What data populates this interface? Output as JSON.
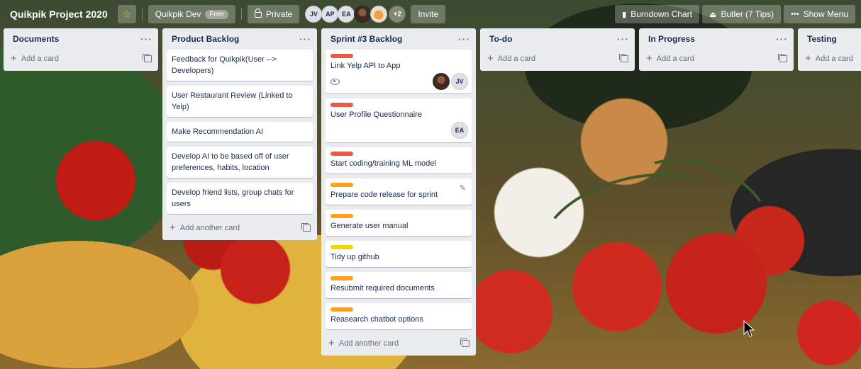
{
  "header": {
    "board_title": "Quikpik Project 2020",
    "team_name": "Quikpik Dev",
    "team_badge": "Free",
    "visibility": "Private",
    "members": [
      "JV",
      "AP",
      "EA"
    ],
    "more_members": "+2",
    "invite": "Invite",
    "burndown": "Burndown Chart",
    "butler": "Butler (7 Tips)",
    "show_menu": "Show Menu"
  },
  "colors": {
    "label_red": "#eb5a46",
    "label_orange": "#ff9f1a",
    "label_yellow": "#f2d600",
    "list_bg": "#ebecf0"
  },
  "lists": [
    {
      "title": "Documents",
      "add_label": "Add a card",
      "cards": []
    },
    {
      "title": "Product Backlog",
      "add_label": "Add another card",
      "cards": [
        {
          "title": "Feedback for Quikpik(User --> Developers)"
        },
        {
          "title": "User Restaurant Review (Linked to Yelp)"
        },
        {
          "title": "Make Recommendation AI"
        },
        {
          "title": "Develop AI to be based off of user preferences, habits, location"
        },
        {
          "title": "Develop friend lists, group chats for users"
        }
      ]
    },
    {
      "title": "Sprint #3 Backlog",
      "add_label": "Add another card",
      "cards": [
        {
          "title": "Link Yelp API to App",
          "label": "red",
          "members": [
            "photo",
            "JV"
          ]
        },
        {
          "title": "User Profile Questionnaire",
          "label": "red",
          "members": [
            "EA"
          ]
        },
        {
          "title": "Start coding/training ML model",
          "label": "red"
        },
        {
          "title": "Prepare code release for sprint",
          "label": "orange"
        },
        {
          "title": "Generate user manual",
          "label": "orange"
        },
        {
          "title": "Tidy up github",
          "label": "yellow"
        },
        {
          "title": "Resubmit required documents",
          "label": "orange"
        },
        {
          "title": "Reasearch chatbot options",
          "label": "orange"
        }
      ]
    },
    {
      "title": "To-do",
      "add_label": "Add a card",
      "cards": []
    },
    {
      "title": "In Progress",
      "add_label": "Add a card",
      "cards": []
    },
    {
      "title": "Testing",
      "add_label": "Add a card",
      "cards": []
    }
  ]
}
